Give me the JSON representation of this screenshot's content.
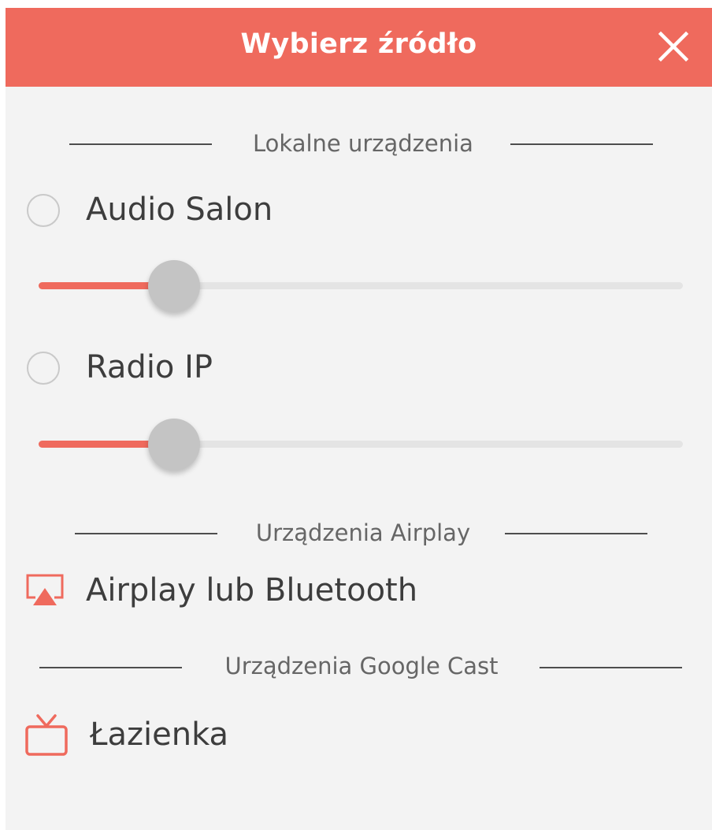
{
  "header": {
    "title": "Wybierz źródło",
    "background": "#ef6a5d",
    "close_icon": "close-icon"
  },
  "sections": {
    "local": {
      "label": "Lokalne urządzenia",
      "devices": [
        {
          "label": "Audio Salon",
          "selected": false,
          "volume_fraction": 0.21
        },
        {
          "label": "Radio IP",
          "selected": false,
          "volume_fraction": 0.21
        }
      ]
    },
    "airplay": {
      "label": "Urządzenia Airplay",
      "device": {
        "label": "Airplay lub Bluetooth",
        "icon": "airplay-icon"
      }
    },
    "cast": {
      "label": "Urządzenia Google Cast",
      "device": {
        "label": "Łazienka",
        "icon": "tv-icon"
      }
    }
  },
  "colors": {
    "accent": "#ef6a5d",
    "background": "#f3f3f3",
    "track": "#e4e4e4",
    "thumb": "#c4c4c4",
    "text": "#3d3d3d"
  }
}
